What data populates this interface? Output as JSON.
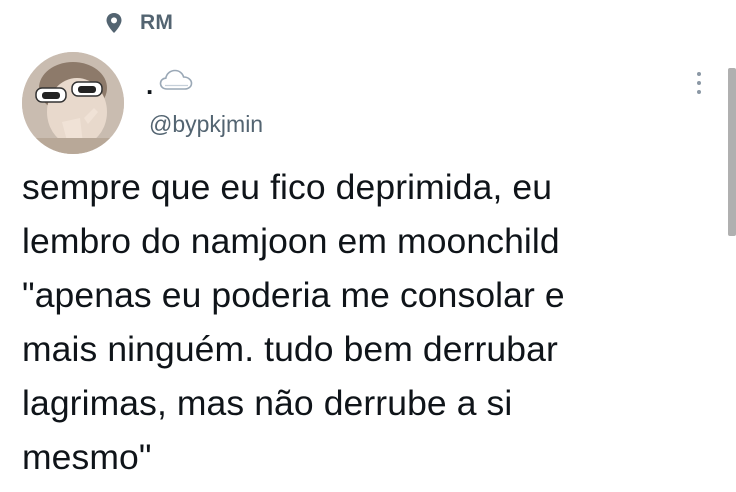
{
  "context": {
    "icon": "location-pin-icon",
    "label": "RM"
  },
  "author": {
    "display_name": ".",
    "name_emoji_icon": "cloud-icon",
    "handle": "@bypkjmin",
    "avatar": "user-avatar"
  },
  "menu": {
    "icon": "more-vertical-icon"
  },
  "tweet": {
    "lines": [
      "sempre que eu fico deprimida, eu",
      "lembro do namjoon em moonchild",
      "\"apenas eu poderia me consolar e",
      "mais ninguém. tudo bem derrubar",
      "lagrimas, mas não derrube a si",
      "mesmo\""
    ]
  },
  "colors": {
    "text": "#0f1419",
    "secondary": "#536471",
    "background": "#ffffff"
  }
}
